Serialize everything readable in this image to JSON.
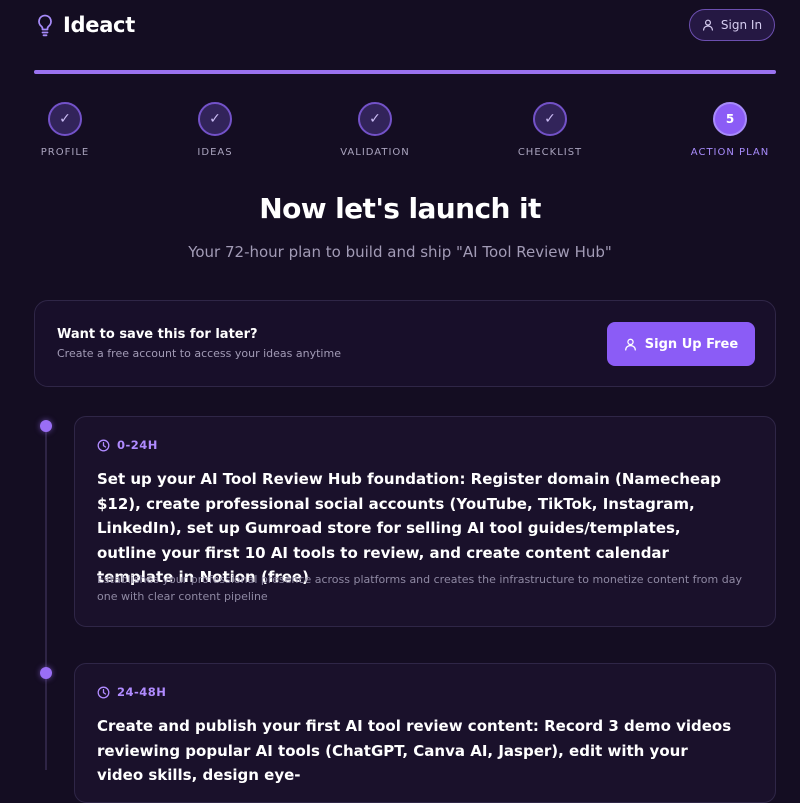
{
  "header": {
    "app_name": "Ideact",
    "sign_in_label": "Sign In"
  },
  "progress": {
    "fraction": 1.0
  },
  "steps": [
    {
      "label": "PROFILE",
      "state": "done"
    },
    {
      "label": "IDEAS",
      "state": "done"
    },
    {
      "label": "VALIDATION",
      "state": "done"
    },
    {
      "label": "CHECKLIST",
      "state": "done"
    },
    {
      "label": "ACTION PLAN",
      "state": "active",
      "number": "5"
    }
  ],
  "hero": {
    "title": "Now let's launch it",
    "subtitle": "Your 72-hour plan to build and ship \"AI Tool Review Hub\""
  },
  "save_prompt": {
    "title": "Want to save this for later?",
    "description": "Create a free account to access your ideas anytime",
    "button_label": "Sign Up Free"
  },
  "timeline": [
    {
      "time": "0-24H",
      "task": "Set up your AI Tool Review Hub foundation: Register domain (Namecheap $12), create professional social accounts (YouTube, TikTok, Instagram, LinkedIn), set up Gumroad store for selling AI tool guides/templates, outline your first 10 AI tools to review, and create content calendar template in Notion (free)",
      "note": "Establishes your professional presence across platforms and creates the infrastructure to monetize content from day one with clear content pipeline"
    },
    {
      "time": "24-48H",
      "task": "Create and publish your first AI tool review content: Record 3 demo videos reviewing popular AI tools (ChatGPT, Canva AI, Jasper), edit with your video skills, design eye-",
      "note": ""
    }
  ],
  "colors": {
    "background": "#140d22",
    "accent": "#8b5cf6",
    "accent_text": "#b08bff",
    "card": "#1a112b"
  },
  "icons": {
    "logo": "lightbulb-icon",
    "sign_in": "user-icon",
    "step_done": "check-icon",
    "time": "clock-icon"
  }
}
